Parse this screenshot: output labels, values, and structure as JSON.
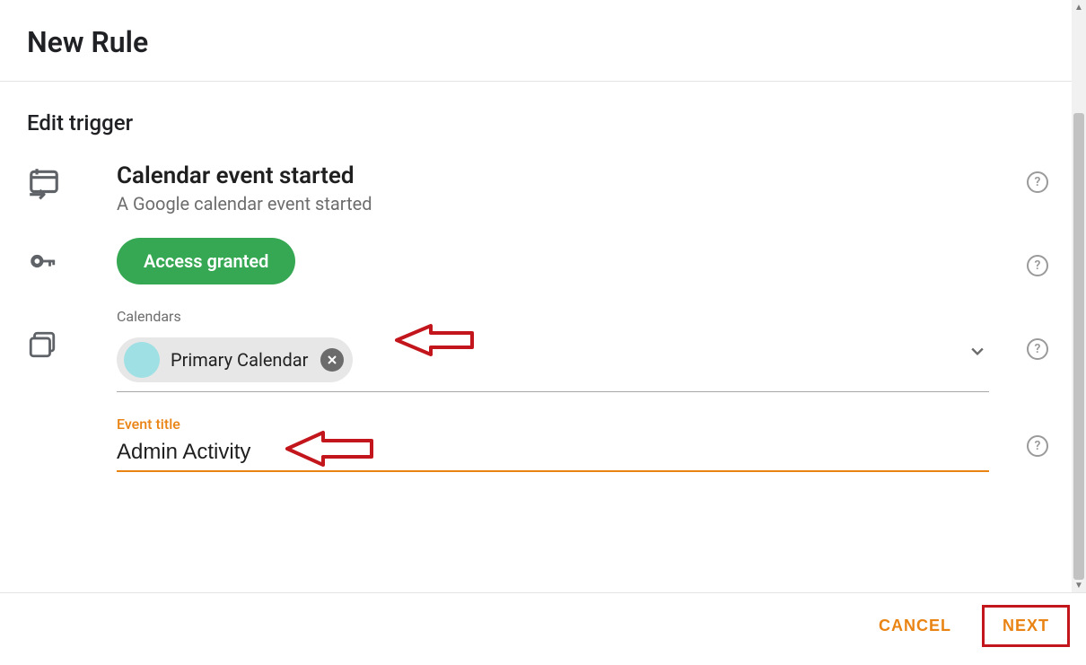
{
  "header": {
    "title": "New Rule"
  },
  "section": {
    "title": "Edit trigger"
  },
  "trigger": {
    "title": "Calendar event started",
    "subtitle": "A Google calendar event started"
  },
  "access": {
    "label": "Access granted"
  },
  "calendars": {
    "label": "Calendars",
    "chips": [
      {
        "name": "Primary Calendar",
        "swatch_color": "#9fe0e4"
      }
    ]
  },
  "event_title_field": {
    "label": "Event title",
    "value": "Admin Activity"
  },
  "footer": {
    "cancel": "CANCEL",
    "next": "NEXT"
  }
}
